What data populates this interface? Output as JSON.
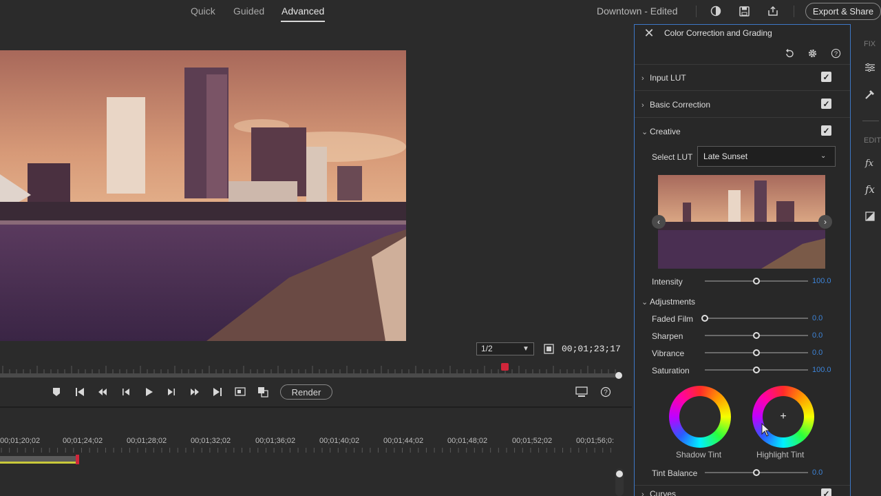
{
  "header": {
    "modes": [
      "Quick",
      "Guided",
      "Advanced"
    ],
    "active_mode": "Advanced",
    "document_title": "Downtown - Edited",
    "export_label": "Export & Share"
  },
  "monitor": {
    "zoom": "1/2",
    "timecode": "00;01;23;17",
    "render_label": "Render"
  },
  "timeline": {
    "ruler": [
      "00;01;20;02",
      "00;01;24;02",
      "00;01;28;02",
      "00;01;32;02",
      "00;01;36;02",
      "00;01;40;02",
      "00;01;44;02",
      "00;01;48;02",
      "00;01;52;02",
      "00;01;56;0:"
    ]
  },
  "panel": {
    "title": "Color Correction and Grading",
    "sections": {
      "input_lut": "Input LUT",
      "basic_correction": "Basic Correction",
      "creative": "Creative",
      "adjustments": "Adjustments",
      "curves": "Curves"
    },
    "select_lut_label": "Select LUT",
    "selected_lut": "Late Sunset",
    "intensity": {
      "label": "Intensity",
      "value": "100.0",
      "fraction": 0.5
    },
    "adjustments": [
      {
        "label": "Faded Film",
        "value": "0.0",
        "fraction": 0.0
      },
      {
        "label": "Sharpen",
        "value": "0.0",
        "fraction": 0.5
      },
      {
        "label": "Vibrance",
        "value": "0.0",
        "fraction": 0.5
      },
      {
        "label": "Saturation",
        "value": "100.0",
        "fraction": 0.5
      }
    ],
    "wheels": {
      "shadow": "Shadow Tint",
      "highlight": "Highlight Tint"
    },
    "tint_balance": {
      "label": "Tint Balance",
      "value": "0.0",
      "fraction": 0.5
    }
  },
  "rail": {
    "fix": "FIX",
    "edit": "EDIT"
  },
  "colors": {
    "accent": "#3d84d8",
    "playhead": "#d0263a",
    "panel_border": "#3d78c8"
  }
}
